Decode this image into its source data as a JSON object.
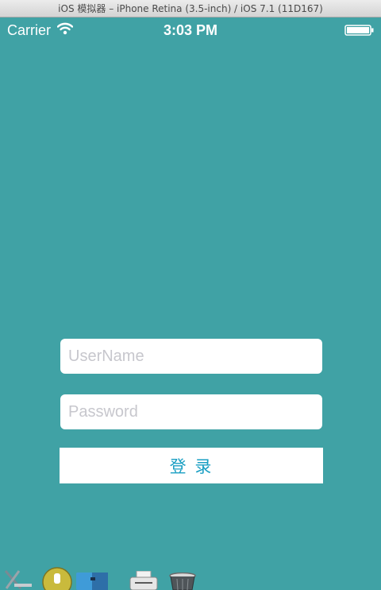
{
  "window": {
    "title": "iOS 模拟器 – iPhone Retina (3.5-inch) / iOS 7.1 (11D167)"
  },
  "statusbar": {
    "carrier": "Carrier",
    "time": "3:03 PM",
    "wifi_icon": "wifi-icon",
    "battery_icon": "battery-icon"
  },
  "login": {
    "username_placeholder": "UserName",
    "username_value": "",
    "password_placeholder": "Password",
    "password_value": "",
    "login_label": "登 录"
  },
  "colors": {
    "background": "#40a2a5",
    "button_text": "#1a9fc3",
    "placeholder": "#c7c7cd"
  },
  "dock": {
    "icons": [
      "tools-icon",
      "utility-icon",
      "finder-icon",
      "printer-icon",
      "trash-icon"
    ]
  }
}
